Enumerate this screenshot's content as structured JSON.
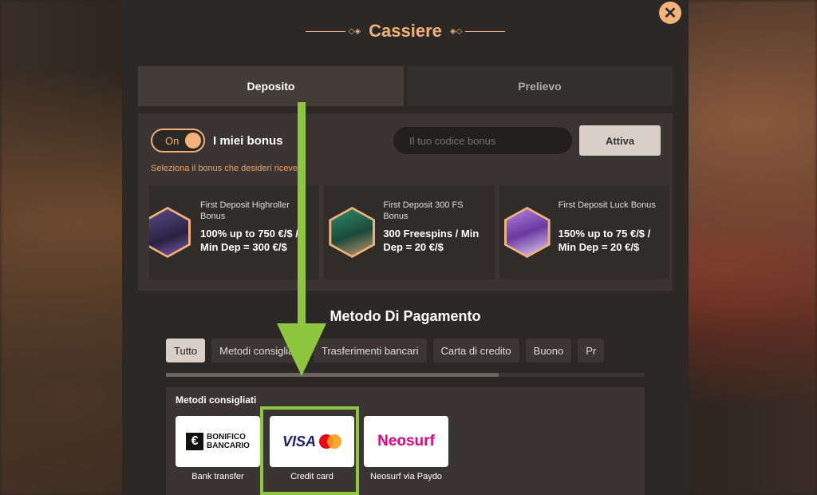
{
  "modal": {
    "title": "Cassiere",
    "close_icon": "close-icon"
  },
  "tabs": [
    {
      "label": "Deposito",
      "active": true
    },
    {
      "label": "Prelievo",
      "active": false
    }
  ],
  "bonus": {
    "toggle_label": "On",
    "toggle_state": true,
    "my_bonus_label": "I miei bonus",
    "code_placeholder": "Il tuo codice bonus",
    "activate_label": "Attiva",
    "select_hint": "Seleziona il bonus che desideri ricevere",
    "cards": [
      {
        "name": "First Deposit Highroller Bonus",
        "description": "100% up to 750 €/$ / Min Dep = 300 €/$"
      },
      {
        "name": "First Deposit 300 FS Bonus",
        "description": "300 Freespins / Min Dep = 20 €/$"
      },
      {
        "name": "First Deposit Luck Bonus",
        "description": "150% up to 75 €/$ / Min Dep = 20 €/$"
      }
    ]
  },
  "payment": {
    "heading": "Metodo Di Pagamento",
    "filters": [
      "Tutto",
      "Metodi consigliati",
      "Trasferimenti bancari",
      "Carta di credito",
      "Buono",
      "Pr"
    ],
    "active_filter": "Tutto",
    "scroll_fraction": 0.7,
    "recommended_title": "Metodi consigliati",
    "methods": [
      {
        "label": "Bank transfer",
        "logo_text": "BONIFICO BANCARIO"
      },
      {
        "label": "Credit card",
        "logo_text": "VISA"
      },
      {
        "label": "Neosurf via Paydo",
        "logo_text": "Neosurf"
      }
    ]
  },
  "colors": {
    "accent": "#f0b07a",
    "highlight": "#8ec63f",
    "neosurf": "#e6007e",
    "visa": "#1a1f71"
  }
}
